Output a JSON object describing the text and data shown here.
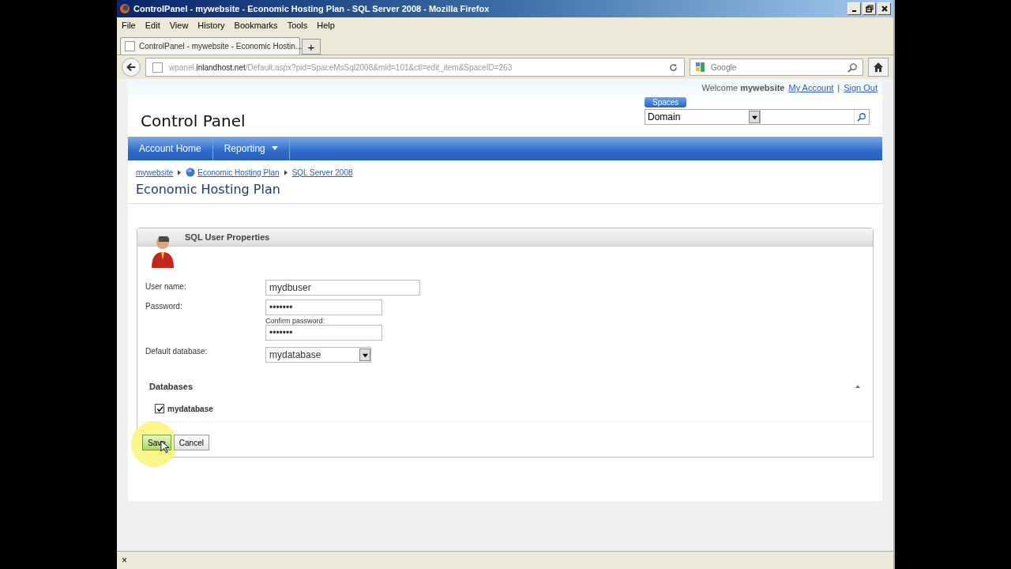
{
  "window": {
    "title": "ControlPanel - mywebsite - Economic Hosting Plan - SQL Server 2008 - Mozilla Firefox"
  },
  "menu": [
    "File",
    "Edit",
    "View",
    "History",
    "Bookmarks",
    "Tools",
    "Help"
  ],
  "tabs": [
    {
      "label": "ControlPanel - mywebsite - Economic Hostin...",
      "selected": true
    }
  ],
  "new_tab": "+",
  "address_bar": {
    "prefix": "wpanel.",
    "host": "inlandhost.net",
    "path": "/Default.aspx?pid=SpaceMsSql2008&mid=101&ctl=edit_item&SpaceID=263"
  },
  "search_box": {
    "placeholder": "Google"
  },
  "header": {
    "welcome": "Welcome **mywebsite**",
    "links": [
      "My Account",
      "Sign Out"
    ],
    "separator": "|",
    "site_title": "Control Panel",
    "spaces_label": "Spaces",
    "spaces_value": "Domain"
  },
  "nav": [
    {
      "label": "Account Home",
      "dropdown": false
    },
    {
      "label": "Reporting",
      "dropdown": true
    }
  ],
  "breadcrumbs": [
    {
      "label": "mywebsite",
      "globe": false
    },
    {
      "label": "Economic Hosting Plan",
      "globe": true
    },
    {
      "label": "SQL Server 2008",
      "globe": false
    }
  ],
  "heading": "Economic Hosting Plan",
  "panel": {
    "title": "SQL User Properties",
    "fields": [
      {
        "kind": "text",
        "label": "User name:",
        "value": "mydbuser"
      },
      {
        "kind": "password",
        "label": "Password:",
        "value": "•••••••",
        "confirm_label": "Confirm password:",
        "confirm_value": "•••••••"
      },
      {
        "kind": "select",
        "label": "Default database:",
        "value": "mydatabase"
      }
    ],
    "databases": {
      "title": "Databases",
      "items": [
        {
          "label": "mydatabase",
          "checked": true
        }
      ]
    },
    "buttons": [
      {
        "label": "Save",
        "highlighted": true
      },
      {
        "label": "Cancel",
        "highlighted": false
      }
    ]
  },
  "status_bar": {
    "close": "×"
  }
}
